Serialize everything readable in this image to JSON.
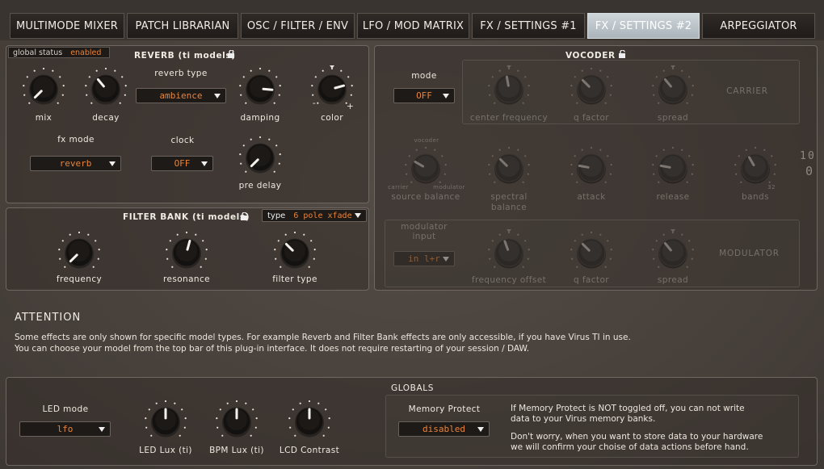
{
  "tabs": [
    {
      "label": "MULTIMODE MIXER",
      "active": false
    },
    {
      "label": "PATCH LIBRARIAN",
      "active": false
    },
    {
      "label": "OSC / FILTER / ENV",
      "active": false
    },
    {
      "label": "LFO / MOD MATRIX",
      "active": false
    },
    {
      "label": "FX / SETTINGS #1",
      "active": false
    },
    {
      "label": "FX / SETTINGS #2",
      "active": true
    },
    {
      "label": "ARPEGGIATOR",
      "active": false
    }
  ],
  "global_status": {
    "label": "global status",
    "value": "enabled"
  },
  "reverb": {
    "title": "REVERB (ti models)",
    "knobs": {
      "mix": "mix",
      "decay": "decay",
      "damping": "damping",
      "color": "color",
      "pre_delay": "pre delay"
    },
    "reverb_type": {
      "label": "reverb type",
      "value": "ambience"
    },
    "fx_mode": {
      "label": "fx mode",
      "value": "reverb"
    },
    "clock": {
      "label": "clock",
      "value": "OFF"
    },
    "color_minus": "-",
    "color_plus": "+"
  },
  "filter_bank": {
    "title": "FILTER BANK (ti models)",
    "type_label": "type",
    "type_value": "6 pole xfade",
    "knobs": {
      "frequency": "frequency",
      "resonance": "resonance",
      "filter_type": "filter type"
    }
  },
  "vocoder": {
    "title": "VOCODER",
    "mode": {
      "label": "mode",
      "value": "OFF"
    },
    "carrier_label": "CARRIER",
    "modulator_label": "MODULATOR",
    "carrier_knobs": {
      "center_frequency": "center frequency",
      "q_factor": "q factor",
      "spread": "spread"
    },
    "mid_knobs": {
      "source_balance": "source balance",
      "spectral_balance_1": "spectral",
      "spectral_balance_2": "balance",
      "attack": "attack",
      "release": "release",
      "bands": "bands"
    },
    "source_balance_marks": {
      "top": "vocoder",
      "left": "carrier",
      "right": "modulator"
    },
    "bands_mark": "32",
    "modulator_input": {
      "label_1": "modulator",
      "label_2": "input",
      "value": "in l+r"
    },
    "modulator_knobs": {
      "frequency_offset": "frequency offset",
      "q_factor": "q factor",
      "spread": "spread"
    },
    "side_digits": [
      "1",
      "0",
      "0"
    ]
  },
  "attention": {
    "title": "ATTENTION",
    "line1": "Some effects are only shown for specific model types. For example Reverb and Filter Bank effects are only accessible, if you have Virus TI in use.",
    "line2": "You can choose your model from the top bar of this plug-in interface. It does not require restarting of your session / DAW."
  },
  "globals": {
    "title": "GLOBALS",
    "led_mode": {
      "label": "LED mode",
      "value": "lfo"
    },
    "knobs": {
      "led_lux": "LED Lux (ti)",
      "bpm_lux": "BPM Lux (ti)",
      "lcd_contrast": "LCD Contrast"
    },
    "memory_protect": {
      "label": "Memory Protect",
      "value": "disabled"
    },
    "info1": "If Memory Protect is NOT toggled off, you can not write",
    "info2": "data to your Virus memory banks.",
    "info3": "Don't worry, when you want to store data to your hardware",
    "info4": "we will confirm your choise of data actions before hand."
  },
  "colors": {
    "accent": "#e8843a",
    "active_tab": "#bcc5ca"
  }
}
